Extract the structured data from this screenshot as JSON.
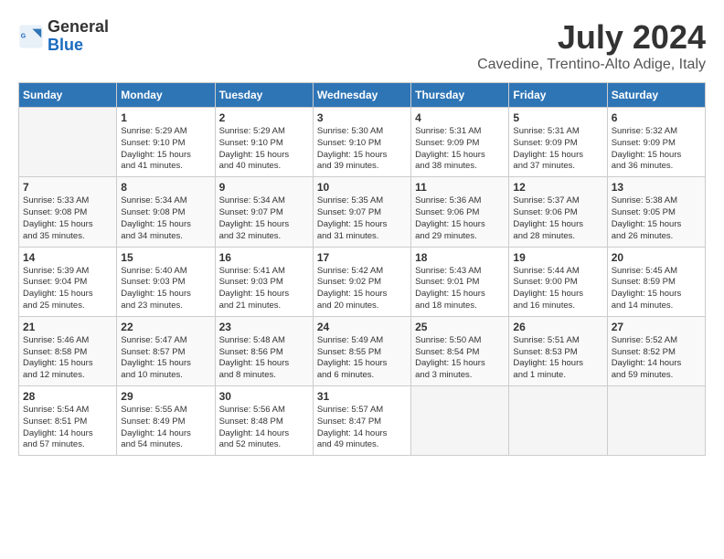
{
  "header": {
    "logo_line1": "General",
    "logo_line2": "Blue",
    "title": "July 2024",
    "subtitle": "Cavedine, Trentino-Alto Adige, Italy"
  },
  "calendar": {
    "days_of_week": [
      "Sunday",
      "Monday",
      "Tuesday",
      "Wednesday",
      "Thursday",
      "Friday",
      "Saturday"
    ],
    "weeks": [
      [
        {
          "day": "",
          "info": ""
        },
        {
          "day": "1",
          "info": "Sunrise: 5:29 AM\nSunset: 9:10 PM\nDaylight: 15 hours\nand 41 minutes."
        },
        {
          "day": "2",
          "info": "Sunrise: 5:29 AM\nSunset: 9:10 PM\nDaylight: 15 hours\nand 40 minutes."
        },
        {
          "day": "3",
          "info": "Sunrise: 5:30 AM\nSunset: 9:10 PM\nDaylight: 15 hours\nand 39 minutes."
        },
        {
          "day": "4",
          "info": "Sunrise: 5:31 AM\nSunset: 9:09 PM\nDaylight: 15 hours\nand 38 minutes."
        },
        {
          "day": "5",
          "info": "Sunrise: 5:31 AM\nSunset: 9:09 PM\nDaylight: 15 hours\nand 37 minutes."
        },
        {
          "day": "6",
          "info": "Sunrise: 5:32 AM\nSunset: 9:09 PM\nDaylight: 15 hours\nand 36 minutes."
        }
      ],
      [
        {
          "day": "7",
          "info": "Sunrise: 5:33 AM\nSunset: 9:08 PM\nDaylight: 15 hours\nand 35 minutes."
        },
        {
          "day": "8",
          "info": "Sunrise: 5:34 AM\nSunset: 9:08 PM\nDaylight: 15 hours\nand 34 minutes."
        },
        {
          "day": "9",
          "info": "Sunrise: 5:34 AM\nSunset: 9:07 PM\nDaylight: 15 hours\nand 32 minutes."
        },
        {
          "day": "10",
          "info": "Sunrise: 5:35 AM\nSunset: 9:07 PM\nDaylight: 15 hours\nand 31 minutes."
        },
        {
          "day": "11",
          "info": "Sunrise: 5:36 AM\nSunset: 9:06 PM\nDaylight: 15 hours\nand 29 minutes."
        },
        {
          "day": "12",
          "info": "Sunrise: 5:37 AM\nSunset: 9:06 PM\nDaylight: 15 hours\nand 28 minutes."
        },
        {
          "day": "13",
          "info": "Sunrise: 5:38 AM\nSunset: 9:05 PM\nDaylight: 15 hours\nand 26 minutes."
        }
      ],
      [
        {
          "day": "14",
          "info": "Sunrise: 5:39 AM\nSunset: 9:04 PM\nDaylight: 15 hours\nand 25 minutes."
        },
        {
          "day": "15",
          "info": "Sunrise: 5:40 AM\nSunset: 9:03 PM\nDaylight: 15 hours\nand 23 minutes."
        },
        {
          "day": "16",
          "info": "Sunrise: 5:41 AM\nSunset: 9:03 PM\nDaylight: 15 hours\nand 21 minutes."
        },
        {
          "day": "17",
          "info": "Sunrise: 5:42 AM\nSunset: 9:02 PM\nDaylight: 15 hours\nand 20 minutes."
        },
        {
          "day": "18",
          "info": "Sunrise: 5:43 AM\nSunset: 9:01 PM\nDaylight: 15 hours\nand 18 minutes."
        },
        {
          "day": "19",
          "info": "Sunrise: 5:44 AM\nSunset: 9:00 PM\nDaylight: 15 hours\nand 16 minutes."
        },
        {
          "day": "20",
          "info": "Sunrise: 5:45 AM\nSunset: 8:59 PM\nDaylight: 15 hours\nand 14 minutes."
        }
      ],
      [
        {
          "day": "21",
          "info": "Sunrise: 5:46 AM\nSunset: 8:58 PM\nDaylight: 15 hours\nand 12 minutes."
        },
        {
          "day": "22",
          "info": "Sunrise: 5:47 AM\nSunset: 8:57 PM\nDaylight: 15 hours\nand 10 minutes."
        },
        {
          "day": "23",
          "info": "Sunrise: 5:48 AM\nSunset: 8:56 PM\nDaylight: 15 hours\nand 8 minutes."
        },
        {
          "day": "24",
          "info": "Sunrise: 5:49 AM\nSunset: 8:55 PM\nDaylight: 15 hours\nand 6 minutes."
        },
        {
          "day": "25",
          "info": "Sunrise: 5:50 AM\nSunset: 8:54 PM\nDaylight: 15 hours\nand 3 minutes."
        },
        {
          "day": "26",
          "info": "Sunrise: 5:51 AM\nSunset: 8:53 PM\nDaylight: 15 hours\nand 1 minute."
        },
        {
          "day": "27",
          "info": "Sunrise: 5:52 AM\nSunset: 8:52 PM\nDaylight: 14 hours\nand 59 minutes."
        }
      ],
      [
        {
          "day": "28",
          "info": "Sunrise: 5:54 AM\nSunset: 8:51 PM\nDaylight: 14 hours\nand 57 minutes."
        },
        {
          "day": "29",
          "info": "Sunrise: 5:55 AM\nSunset: 8:49 PM\nDaylight: 14 hours\nand 54 minutes."
        },
        {
          "day": "30",
          "info": "Sunrise: 5:56 AM\nSunset: 8:48 PM\nDaylight: 14 hours\nand 52 minutes."
        },
        {
          "day": "31",
          "info": "Sunrise: 5:57 AM\nSunset: 8:47 PM\nDaylight: 14 hours\nand 49 minutes."
        },
        {
          "day": "",
          "info": ""
        },
        {
          "day": "",
          "info": ""
        },
        {
          "day": "",
          "info": ""
        }
      ]
    ]
  }
}
